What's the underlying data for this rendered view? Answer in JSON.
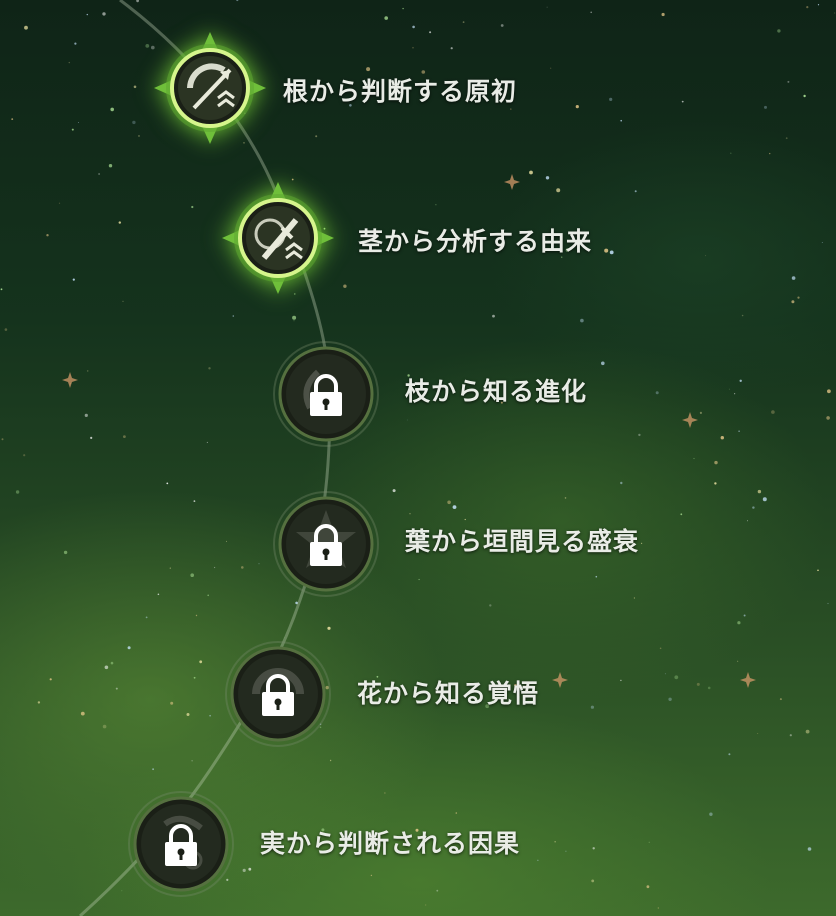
{
  "talents": [
    {
      "label": "根から判断する原初",
      "state": "unlocked",
      "icon": "arrow-chevron-icon"
    },
    {
      "label": "茎から分析する由来",
      "state": "unlocked",
      "icon": "sword-chevron-icon"
    },
    {
      "label": "枝から知る進化",
      "state": "locked",
      "icon": "lock-icon"
    },
    {
      "label": "葉から垣間見る盛衰",
      "state": "locked",
      "icon": "lock-icon"
    },
    {
      "label": "花から知る覚悟",
      "state": "locked",
      "icon": "lock-icon"
    },
    {
      "label": "実から判断される因果",
      "state": "locked",
      "icon": "lock-icon"
    }
  ],
  "colors": {
    "glow": "#8cf03c",
    "ring_unlocked": "#c8f07a",
    "ring_locked": "#3f5a35",
    "node_fill": "#1a1f16",
    "label": "#e9ece6"
  }
}
